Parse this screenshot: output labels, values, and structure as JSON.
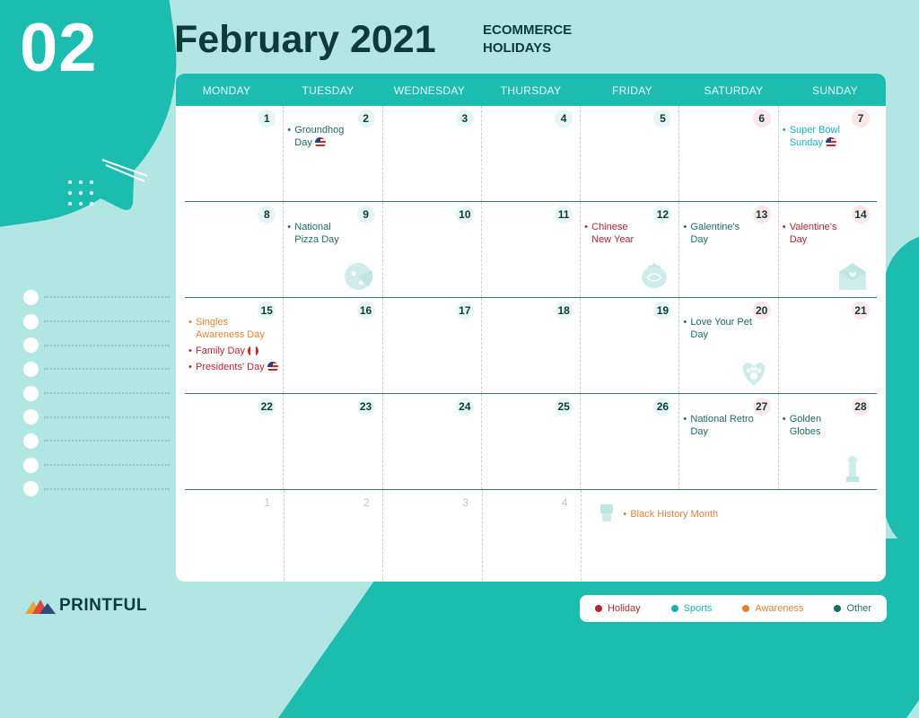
{
  "header": {
    "month_number": "02",
    "title": "February 2021",
    "subtitle_line1": "ECOMMERCE",
    "subtitle_line2": "HOLIDAYS"
  },
  "days": [
    "MONDAY",
    "TUESDAY",
    "WEDNESDAY",
    "THURSDAY",
    "FRIDAY",
    "SATURDAY",
    "SUNDAY"
  ],
  "weeks": [
    {
      "dates": [
        "1",
        "2",
        "3",
        "4",
        "5",
        "6",
        "7"
      ],
      "events": {
        "tue": {
          "line1": "Groundhog",
          "line2": "Day"
        },
        "sun": {
          "line1": "Super Bowl",
          "line2": "Sunday"
        }
      }
    },
    {
      "dates": [
        "8",
        "9",
        "10",
        "11",
        "12",
        "13",
        "14"
      ],
      "events": {
        "tue": {
          "line1": "National",
          "line2": "Pizza Day"
        },
        "fri": {
          "line1": "Chinese",
          "line2": "New Year"
        },
        "sat": {
          "line1": "Galentine's",
          "line2": "Day"
        },
        "sun": {
          "line1": "Valentine's",
          "line2": "Day"
        }
      }
    },
    {
      "dates": [
        "15",
        "16",
        "17",
        "18",
        "19",
        "20",
        "21"
      ],
      "events": {
        "mon": [
          {
            "line1": "Singles",
            "line2": "Awareness Day"
          },
          {
            "line1": "Family Day"
          },
          {
            "line1": "Presidents' Day"
          }
        ],
        "sat": {
          "line1": "Love Your Pet",
          "line2": "Day"
        }
      }
    },
    {
      "dates": [
        "22",
        "23",
        "24",
        "25",
        "26",
        "27",
        "28"
      ],
      "events": {
        "sat": {
          "line1": "National Retro",
          "line2": "Day"
        },
        "sun": {
          "line1": "Golden",
          "line2": "Globes"
        }
      }
    },
    {
      "dates": [
        "1",
        "2",
        "3",
        "4"
      ],
      "events": {
        "month": {
          "line1": "Black History Month"
        }
      }
    }
  ],
  "legend": {
    "holiday": "Holiday",
    "sports": "Sports",
    "awareness": "Awareness",
    "other": "Other"
  },
  "colors": {
    "holiday": "#b3262f",
    "sports": "#19afc0",
    "awareness": "#e08238",
    "other": "#1f6a66",
    "accent": "#1cbcb1"
  },
  "brand": {
    "name": "PRINTFUL"
  }
}
